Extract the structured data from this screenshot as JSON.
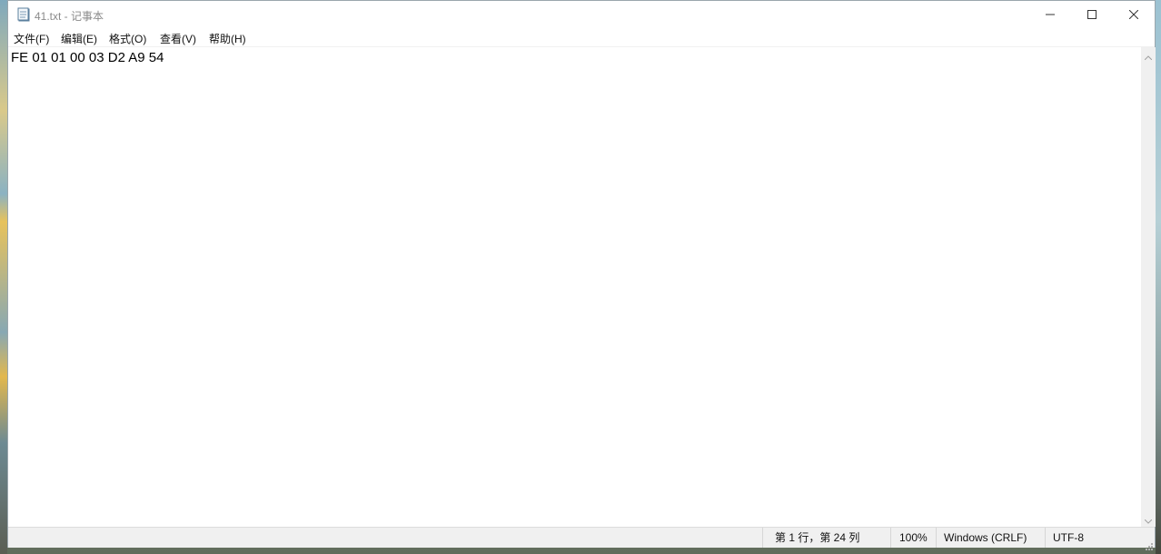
{
  "window": {
    "title": "41.txt - 记事本"
  },
  "menu": {
    "items": [
      {
        "label": "文件(F)"
      },
      {
        "label": "编辑(E)"
      },
      {
        "label": "格式(O)"
      },
      {
        "label": "查看(V)"
      },
      {
        "label": "帮助(H)"
      }
    ]
  },
  "editor": {
    "content": "FE 01 01 00 03 D2 A9 54"
  },
  "status": {
    "position": "第 1 行，第 24 列",
    "zoom": "100%",
    "line_ending": "Windows (CRLF)",
    "encoding": "UTF-8"
  },
  "icons": {
    "app": "notepad-icon",
    "minimize": "minimize-icon",
    "maximize": "maximize-icon",
    "close": "close-icon"
  }
}
